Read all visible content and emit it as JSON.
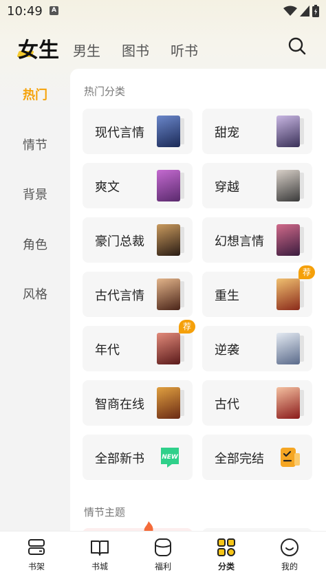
{
  "status": {
    "time": "10:49",
    "a_icon": "A"
  },
  "tabs": {
    "active": "女生",
    "others": [
      "男生",
      "图书",
      "听书"
    ]
  },
  "sidebar": {
    "items": [
      "热门",
      "情节",
      "背景",
      "角色",
      "风格"
    ],
    "active_index": 0
  },
  "sections": [
    {
      "title": "热门分类"
    },
    {
      "title": "情节主题"
    }
  ],
  "categories": [
    {
      "label": "现代言情",
      "cover": "book-cover",
      "cover_colors": [
        "#1b2a57",
        "#6a86c9"
      ]
    },
    {
      "label": "甜宠",
      "cover": "book-cover",
      "cover_colors": [
        "#3a3158",
        "#c8b6e2"
      ]
    },
    {
      "label": "爽文",
      "cover": "book-cover",
      "cover_colors": [
        "#5a2a6d",
        "#c46ad0"
      ]
    },
    {
      "label": "穿越",
      "cover": "book-cover",
      "cover_colors": [
        "#3a3a3a",
        "#d8d0c8"
      ]
    },
    {
      "label": "豪门总裁",
      "cover": "book-cover",
      "cover_colors": [
        "#2a1c14",
        "#c99a5e"
      ]
    },
    {
      "label": "幻想言情",
      "cover": "book-cover",
      "cover_colors": [
        "#3b1c3e",
        "#d06a8a"
      ]
    },
    {
      "label": "古代言情",
      "cover": "book-cover",
      "cover_colors": [
        "#4a2418",
        "#e2b48a"
      ]
    },
    {
      "label": "重生",
      "cover": "book-cover",
      "cover_colors": [
        "#8a2a1a",
        "#f0c070"
      ],
      "badge": "荐"
    },
    {
      "label": "年代",
      "cover": "book-cover",
      "cover_colors": [
        "#5a1a1a",
        "#e28a7a"
      ],
      "badge": "荐"
    },
    {
      "label": "逆袭",
      "cover": "book-cover",
      "cover_colors": [
        "#5a6a8a",
        "#e4eaf2"
      ]
    },
    {
      "label": "智商在线",
      "cover": "book-cover",
      "cover_colors": [
        "#6a2a14",
        "#e0a040"
      ]
    },
    {
      "label": "古代",
      "cover": "book-cover",
      "cover_colors": [
        "#8a1a1a",
        "#f4c0a0"
      ]
    },
    {
      "label": "全部新书",
      "cover": "new-icon",
      "icon_text": "NEW"
    },
    {
      "label": "全部完结",
      "cover": "checklist-icon"
    }
  ],
  "bottom_nav": [
    {
      "label": "书架",
      "icon": "bookshelf-icon"
    },
    {
      "label": "书城",
      "icon": "open-book-icon"
    },
    {
      "label": "福利",
      "icon": "gift-bag-icon"
    },
    {
      "label": "分类",
      "icon": "category-grid-icon",
      "active": true
    },
    {
      "label": "我的",
      "icon": "profile-icon"
    }
  ],
  "colors": {
    "accent": "#f5a20a",
    "highlight": "#f5c518",
    "new_green": "#2fd08a",
    "complete_orange": "#f5a623"
  }
}
